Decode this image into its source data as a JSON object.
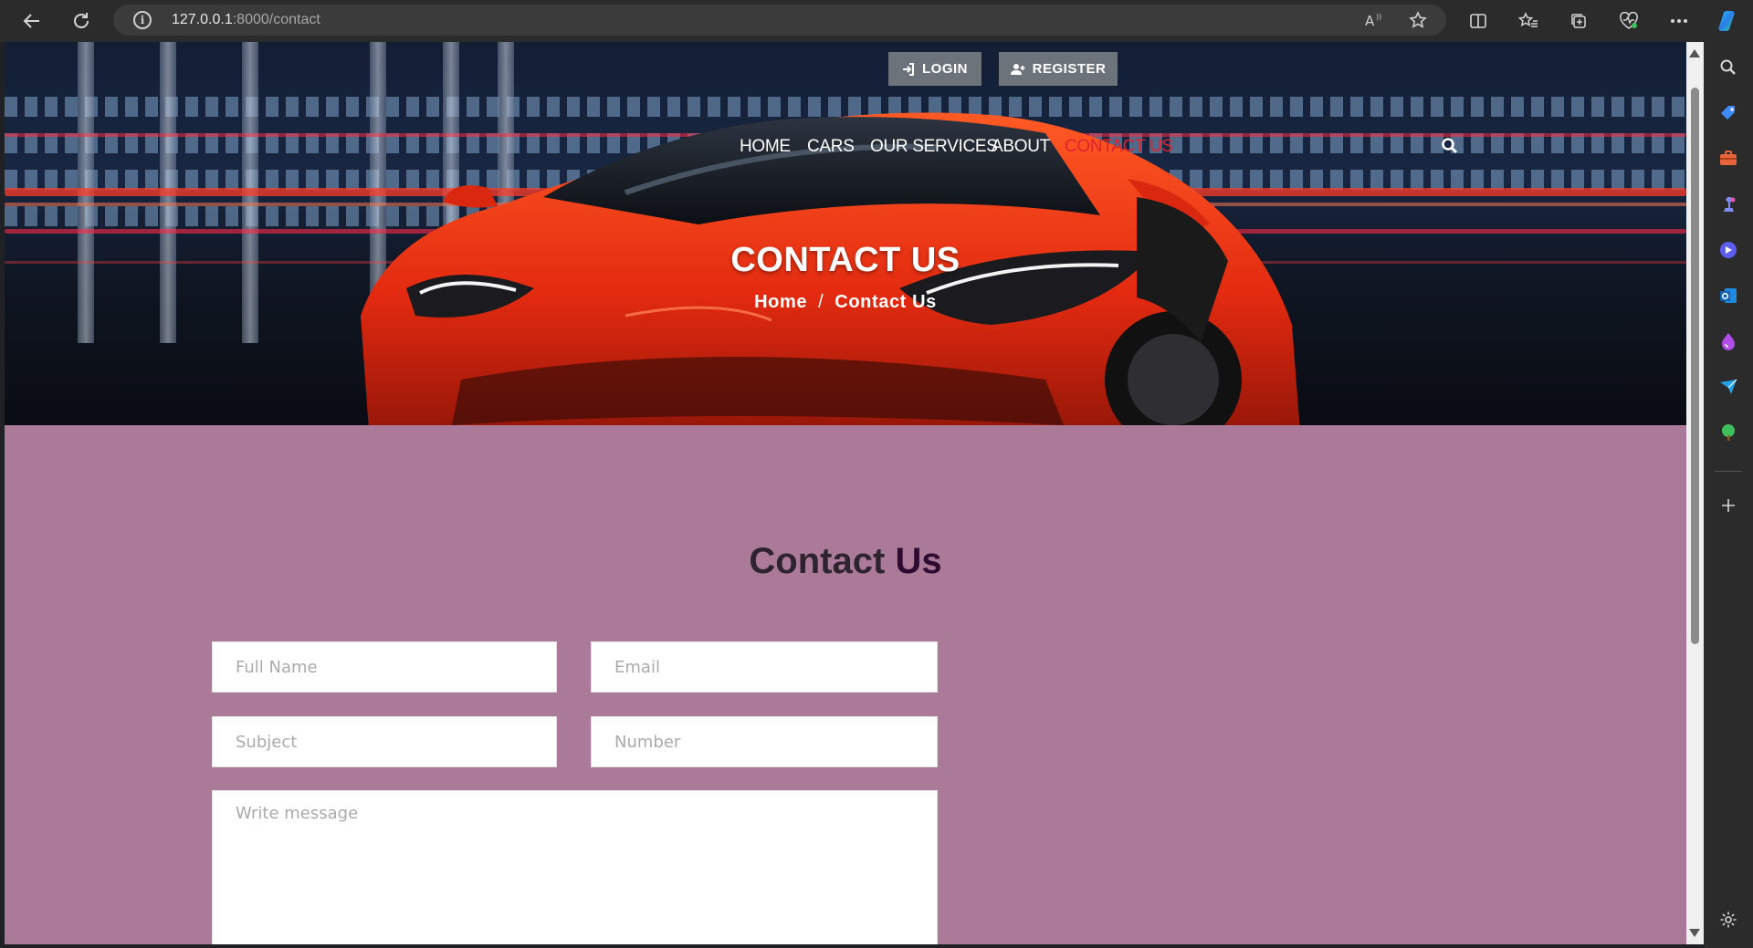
{
  "browser": {
    "url_host": "127.0.0.1",
    "url_path": ":8000/contact",
    "icons": [
      "back-arrow-icon",
      "refresh-icon",
      "site-info-icon",
      "read-aloud-icon",
      "favorite-star-icon",
      "split-screen-icon",
      "favorites-icon",
      "collections-icon",
      "browser-essentials-icon",
      "more-options-icon",
      "copilot-icon"
    ]
  },
  "sidebar": {
    "icons": [
      "search-icon",
      "shopping-tag-icon",
      "tools-icon",
      "games-icon",
      "copilot-app-icon",
      "outlook-icon",
      "drop-icon",
      "send-icon",
      "tree-icon",
      "add-icon",
      "settings-icon"
    ]
  },
  "header": {
    "login_label": "LOGIN",
    "register_label": "REGISTER",
    "nav": [
      "HOME",
      "CARS",
      "OUR SERVICES",
      "ABOUT",
      "CONTACT US"
    ],
    "active_nav": "CONTACT US",
    "hero_title": "CONTACT US",
    "breadcrumb_home": "Home",
    "breadcrumb_sep": "/",
    "breadcrumb_current": "Contact Us"
  },
  "contact": {
    "title_part1": "Contact",
    "title_part2": "Us",
    "full_name_placeholder": "Full Name",
    "email_placeholder": "Email",
    "subject_placeholder": "Subject",
    "number_placeholder": "Number",
    "message_placeholder": "Write message"
  },
  "colors": {
    "page_background": "#ab7a98",
    "active_nav": "#e0222f",
    "auth_button": "#6c737a"
  }
}
